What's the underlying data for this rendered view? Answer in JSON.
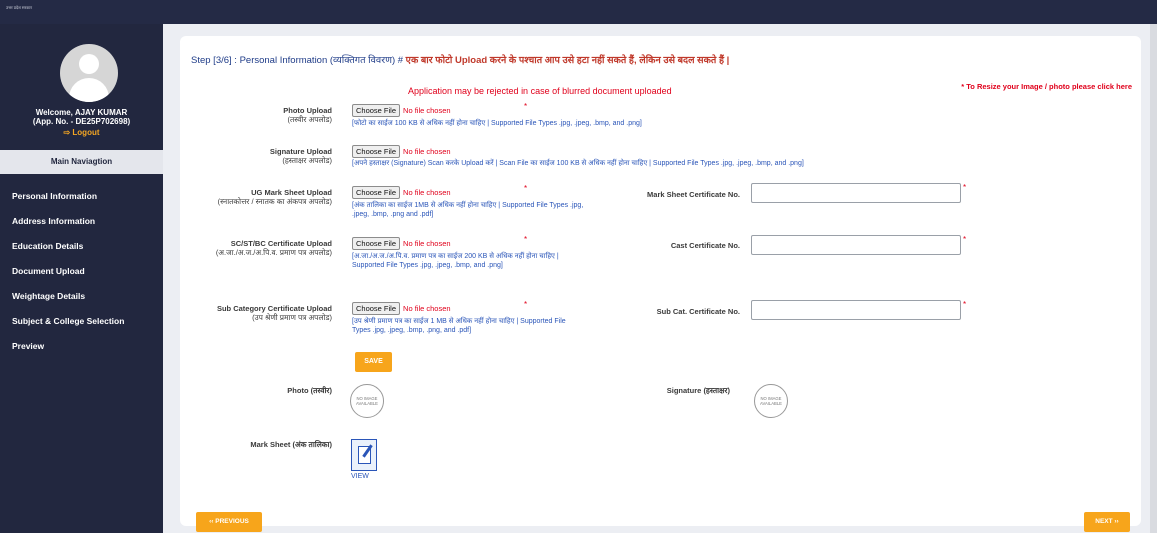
{
  "topbar": {
    "logo_text": "उत्तर प्रदेश सरकार"
  },
  "sidebar": {
    "welcome": "Welcome, AJAY KUMAR",
    "app_no": "(App. No. - DE25P702698)",
    "logout": "⇨ Logout",
    "main_nav": "Main Naviagtion",
    "items": [
      {
        "label": "Personal Information"
      },
      {
        "label": "Address Information"
      },
      {
        "label": "Education Details"
      },
      {
        "label": "Document Upload"
      },
      {
        "label": "Weightage Details"
      },
      {
        "label": "Subject & College Selection"
      },
      {
        "label": "Preview"
      }
    ]
  },
  "form": {
    "step_prefix": "Step [3/6] : Personal Information (व्यक्तिगत विवरण) #",
    "step_note": " एक बार फोटो Upload करने के पश्चात आप उसे हटा नहीं सकते हैं, लेकिन उसे बदल सकते हैं |",
    "warning": "Application may be rejected in case of blurred document uploaded",
    "resize_link": "* To Resize your Image / photo please click here",
    "choose_file": "Choose File",
    "no_file": "No file chosen",
    "required_mark": "*",
    "photo": {
      "label": "Photo Upload",
      "hindi": "(तस्वीर अपलोड)",
      "hint": "[फोटो का साईज 100 KB से अधिक नहीं होना चाहिए | Supported File Types .jpg, .jpeg, .bmp, and .png]"
    },
    "signature": {
      "label": "Signature Upload",
      "hindi": "(हस्ताक्षर अपलोड)",
      "hint": "[अपने हस्ताक्षर (Signature) Scan करके Upload करें | Scan File का साईज 100 KB से अधिक नहीं होना चाहिए | Supported File Types .jpg, .jpeg, .bmp, and .png]"
    },
    "marksheet": {
      "label": "UG Mark Sheet Upload",
      "hindi": "(स्नातकोत्तर / स्नातक का अंकपत्र अपलोड)",
      "hint": "[अंक तालिका का साईज 1MB से अधिक नहीं होना चाहिए | Supported File Types .jpg, .jpeg, .bmp, .png and .pdf]",
      "cert_label": "Mark Sheet Certificate No."
    },
    "caste": {
      "label": "SC/ST/BC Certificate Upload",
      "hindi": "(अ.जा./अ.ज./अ.पि.व. प्रमाण पत्र अपलोड)",
      "hint": "[अ.जा./अ.ज./अ.पि.व. प्रमाण पत्र का साईज 200 KB से अधिक नहीं होना चाहिए | Supported File Types .jpg, .jpeg, .bmp, and .png]",
      "cert_label": "Cast Certificate No."
    },
    "subcat": {
      "label": "Sub Category Certificate Upload",
      "hindi": "(उप श्रेणी प्रमाण पत्र अपलोड)",
      "hint": "[उप श्रेणी प्रमाण पत्र का साईज 1 MB से अधिक नहीं होना चाहिए | Supported File Types .jpg, .jpeg, .bmp, .png, and .pdf]",
      "cert_label": "Sub Cat. Certificate No."
    },
    "save": "SAVE",
    "preview_photo": "Photo (तस्वीर)",
    "preview_signature": "Signature (हस्ताक्षर)",
    "preview_marksheet": "Mark Sheet (अंक तालिका)",
    "no_image_1": "NO IMAGE",
    "no_image_2": "AVAILABLE",
    "view": "VIEW",
    "previous": "‹‹ PREVIOUS",
    "next": "NEXT ››"
  }
}
